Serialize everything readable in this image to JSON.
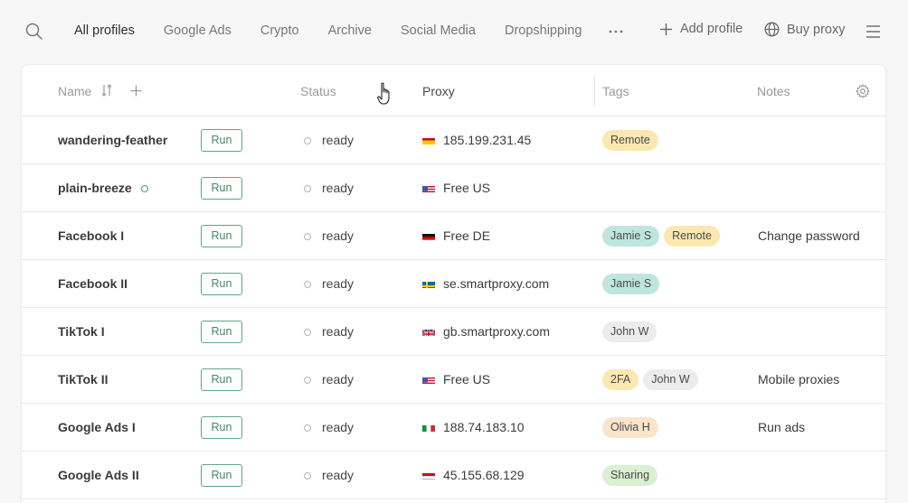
{
  "nav": {
    "tabs": [
      {
        "label": "All profiles",
        "active": true
      },
      {
        "label": "Google Ads"
      },
      {
        "label": "Crypto"
      },
      {
        "label": "Archive"
      },
      {
        "label": "Social Media"
      },
      {
        "label": "Dropshipping"
      }
    ],
    "more_icon": "ellipsis-icon",
    "add_profile": "Add profile",
    "buy_proxy": "Buy proxy"
  },
  "table": {
    "headers": {
      "name": "Name",
      "status": "Status",
      "proxy": "Proxy",
      "tags": "Tags",
      "notes": "Notes"
    },
    "run_label": "Run",
    "rows": [
      {
        "name": "wandering-feather",
        "status": "ready",
        "flag": "es",
        "proxy": "185.199.231.45",
        "tags": [
          {
            "label": "Remote",
            "color": "#fbe8b0"
          }
        ],
        "note": ""
      },
      {
        "name": "plain-breeze",
        "online": true,
        "status": "ready",
        "flag": "us",
        "proxy": "Free US",
        "tags": [],
        "note": ""
      },
      {
        "name": "Facebook I",
        "status": "ready",
        "flag": "de",
        "proxy": "Free DE",
        "tags": [
          {
            "label": "Jamie S",
            "color": "#bfe6dd"
          },
          {
            "label": "Remote",
            "color": "#fbe8b0"
          }
        ],
        "note": "Change password"
      },
      {
        "name": "Facebook II",
        "status": "ready",
        "flag": "se",
        "proxy": "se.smartproxy.com",
        "tags": [
          {
            "label": "Jamie S",
            "color": "#bfe6dd"
          }
        ],
        "note": ""
      },
      {
        "name": "TikTok I",
        "status": "ready",
        "flag": "gb",
        "proxy": "gb.smartproxy.com",
        "tags": [
          {
            "label": "John W",
            "color": "#ececec"
          }
        ],
        "note": ""
      },
      {
        "name": "TikTok II",
        "status": "ready",
        "flag": "us",
        "proxy": "Free US",
        "tags": [
          {
            "label": "2FA",
            "color": "#fbe8b0"
          },
          {
            "label": "John W",
            "color": "#ececec"
          }
        ],
        "note": "Mobile proxies"
      },
      {
        "name": "Google Ads I",
        "status": "ready",
        "flag": "it",
        "proxy": "188.74.183.10",
        "tags": [
          {
            "label": "Olivia H",
            "color": "#fbe3cc"
          }
        ],
        "note": "Run ads"
      },
      {
        "name": "Google Ads II",
        "status": "ready",
        "flag": "nl",
        "proxy": "45.155.68.129",
        "tags": [
          {
            "label": "Sharing",
            "color": "#d9f0d3"
          }
        ],
        "note": ""
      }
    ]
  }
}
